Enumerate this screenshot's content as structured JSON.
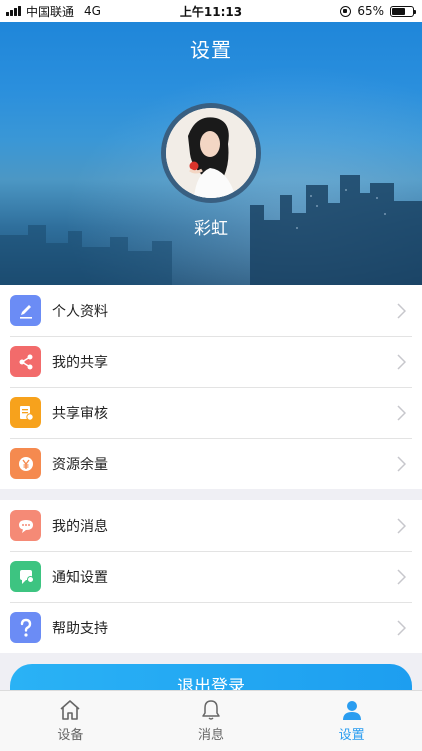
{
  "status_bar": {
    "carrier": "中国联通",
    "network": "4G",
    "time": "上午11:13",
    "battery": "65%",
    "battery_level": 0.65
  },
  "header": {
    "title": "设置",
    "username": "彩虹"
  },
  "menu_group_1": [
    {
      "label": "个人资料",
      "icon": "edit-icon",
      "color": "#6b8cf5"
    },
    {
      "label": "我的共享",
      "icon": "share-icon",
      "color": "#f26b6b"
    },
    {
      "label": "共享审核",
      "icon": "audit-icon",
      "color": "#f7a21c"
    },
    {
      "label": "资源余量",
      "icon": "yuan-icon",
      "color": "#f58a4f"
    }
  ],
  "menu_group_2": [
    {
      "label": "我的消息",
      "icon": "message-icon",
      "color": "#f58a76"
    },
    {
      "label": "通知设置",
      "icon": "notification-icon",
      "color": "#3dc481"
    },
    {
      "label": "帮助支持",
      "icon": "help-icon",
      "color": "#6b8cf5"
    }
  ],
  "logout_label": "退出登录",
  "tabbar": [
    {
      "label": "设备",
      "icon": "home-icon",
      "active": false
    },
    {
      "label": "消息",
      "icon": "bell-icon",
      "active": false
    },
    {
      "label": "设置",
      "icon": "person-icon",
      "active": true
    }
  ],
  "colors": {
    "accent": "#2a9df0"
  }
}
